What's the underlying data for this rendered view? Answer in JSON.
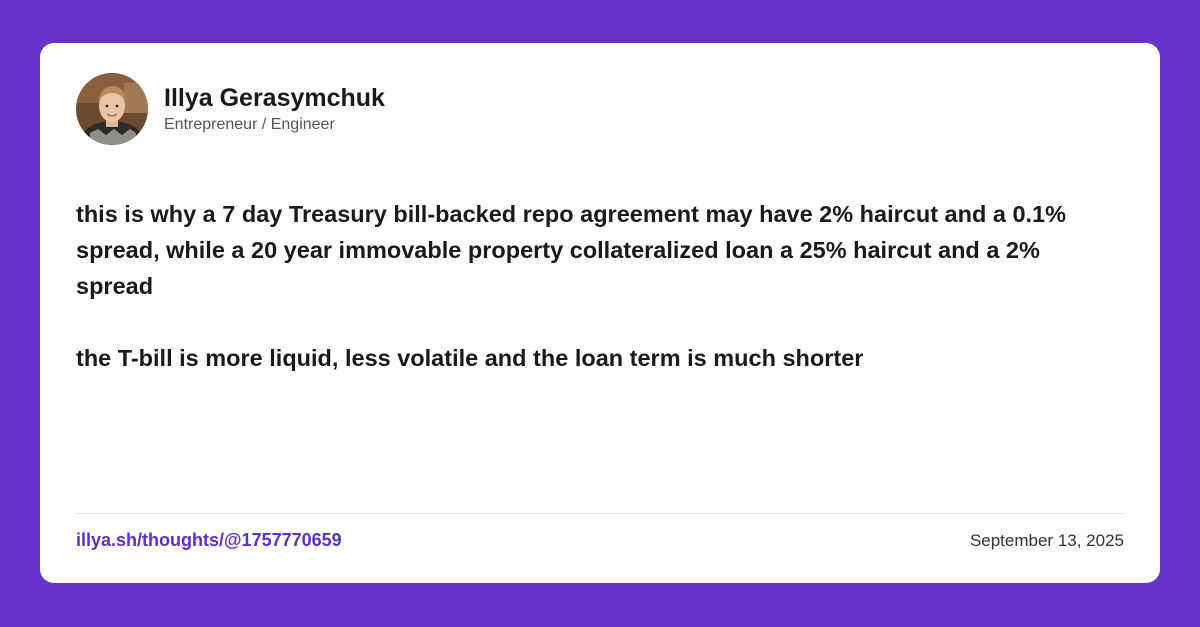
{
  "author": {
    "name": "Illya Gerasymchuk",
    "title": "Entrepreneur / Engineer"
  },
  "post": {
    "paragraphs": [
      "this is why a 7 day Treasury bill-backed repo agreement may have 2% haircut and a 0.1% spread, while a 20 year immovable property collateralized loan a 25% haircut and a 2% spread",
      "the T-bill is more liquid, less volatile and the loan term is much shorter"
    ]
  },
  "footer": {
    "link": "illya.sh/thoughts/@1757770659",
    "date": "September 13, 2025"
  },
  "colors": {
    "background": "#6633cc",
    "link": "#5b2fc9",
    "card": "#ffffff"
  }
}
